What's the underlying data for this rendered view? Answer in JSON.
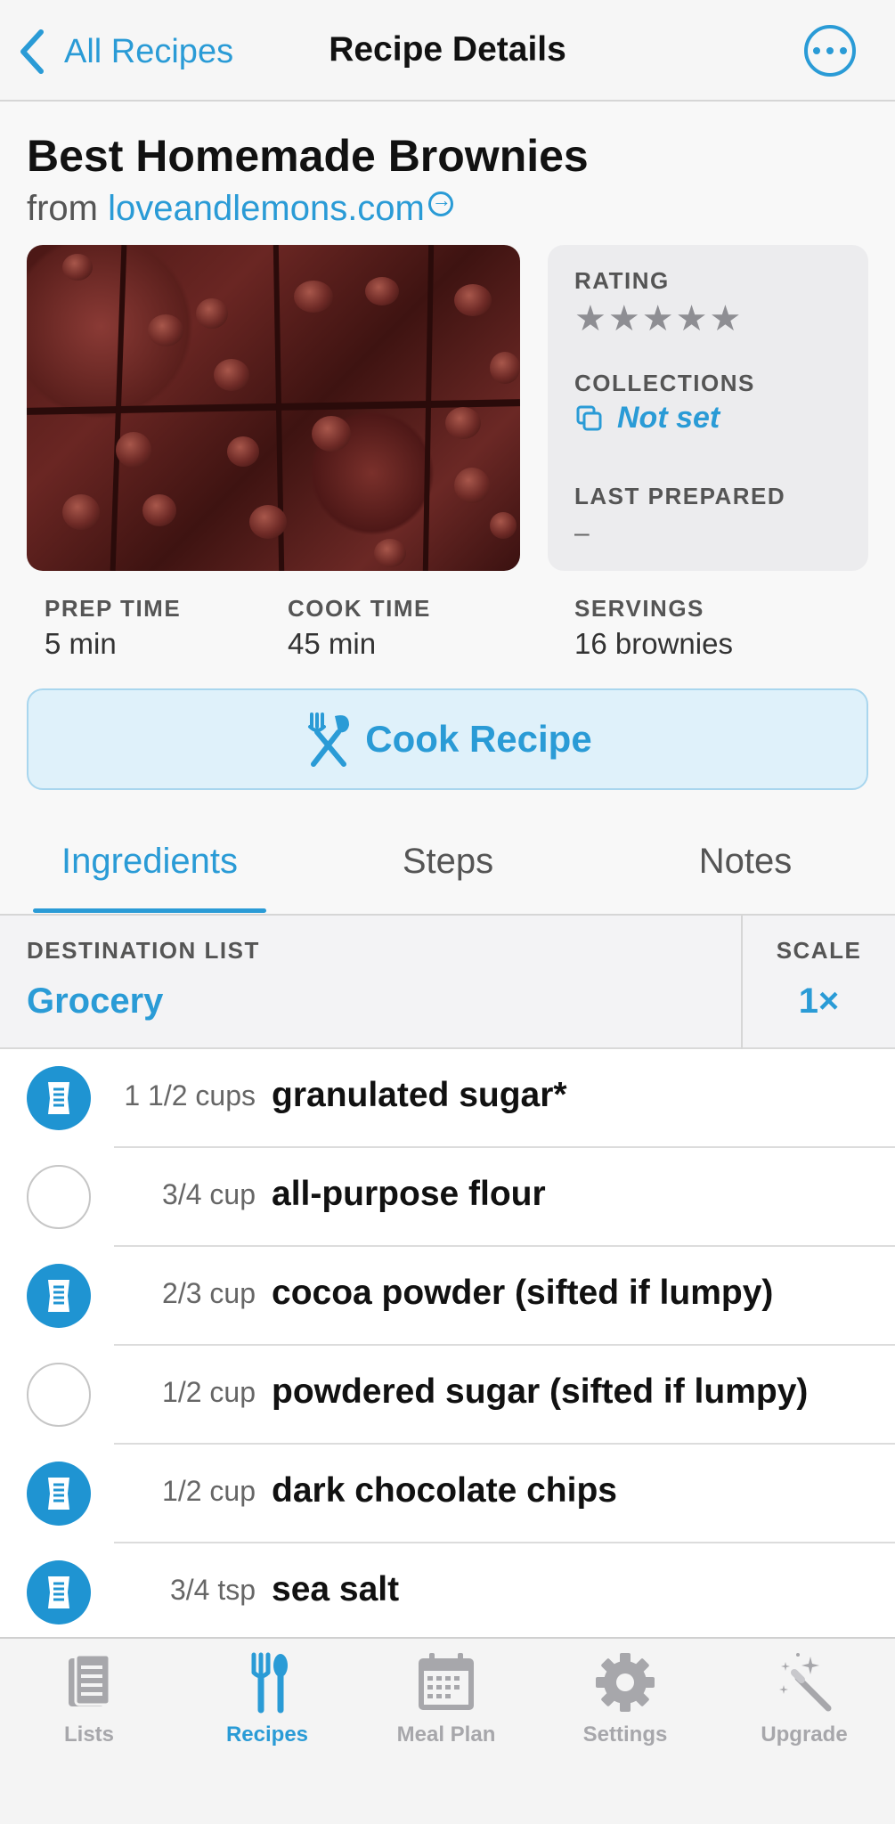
{
  "nav": {
    "back_label": "All Recipes",
    "title": "Recipe Details"
  },
  "recipe": {
    "title": "Best Homemade Brownies",
    "source_prefix": "from",
    "source_link": "loveandlemons.com",
    "rating_label": "RATING",
    "rating_stars": "★★★★★",
    "rating_value": 0,
    "collections_label": "COLLECTIONS",
    "collections_value": "Not set",
    "last_prepared_label": "LAST PREPARED",
    "last_prepared_value": "–",
    "prep_label": "PREP TIME",
    "prep_value": "5 min",
    "cook_label": "COOK TIME",
    "cook_value": "45 min",
    "servings_label": "SERVINGS",
    "servings_value": "16 brownies"
  },
  "cook_button": "Cook Recipe",
  "tabs": [
    {
      "label": "Ingredients",
      "active": true
    },
    {
      "label": "Steps",
      "active": false
    },
    {
      "label": "Notes",
      "active": false
    }
  ],
  "destination": {
    "label": "DESTINATION LIST",
    "value": "Grocery",
    "scale_label": "SCALE",
    "scale_value": "1×"
  },
  "ingredients": [
    {
      "qty": "1 1/2 cups",
      "name": "granulated sugar*",
      "checked": true
    },
    {
      "qty": "3/4 cup",
      "name": "all-purpose flour",
      "checked": false
    },
    {
      "qty": "2/3 cup",
      "name": "cocoa powder (sifted if lumpy)",
      "checked": true
    },
    {
      "qty": "1/2 cup",
      "name": "powdered sugar (sifted if lumpy)",
      "checked": false
    },
    {
      "qty": "1/2 cup",
      "name": "dark chocolate chips",
      "checked": true
    },
    {
      "qty": "3/4 tsp",
      "name": "sea salt",
      "checked": true
    }
  ],
  "tabbar": [
    {
      "label": "Lists",
      "icon": "list-icon",
      "active": false
    },
    {
      "label": "Recipes",
      "icon": "fork-spoon-icon",
      "active": true
    },
    {
      "label": "Meal Plan",
      "icon": "calendar-icon",
      "active": false
    },
    {
      "label": "Settings",
      "icon": "gear-icon",
      "active": false
    },
    {
      "label": "Upgrade",
      "icon": "magic-wand-icon",
      "active": false
    }
  ],
  "colors": {
    "accent": "#2a9bd6",
    "check_fill": "#1f94d2",
    "cook_bg": "#dff1fa"
  }
}
